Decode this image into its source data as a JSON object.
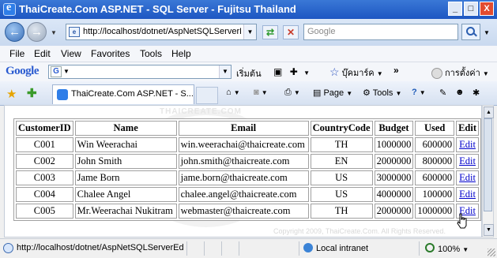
{
  "window": {
    "title": "ThaiCreate.Com ASP.NET - SQL Server - Fujitsu Thailand",
    "controls": {
      "minimize": "_",
      "maximize": "□",
      "close": "X"
    }
  },
  "nav": {
    "back_icon": "back-arrow-icon",
    "forward_icon": "forward-arrow-icon",
    "address": "http://localhost/dotnet/AspNetSQLServerE",
    "search_placeholder": "Google"
  },
  "menu": [
    "File",
    "Edit",
    "View",
    "Favorites",
    "Tools",
    "Help"
  ],
  "google_toolbar": {
    "logo": "Google",
    "start_label": "เริ่มต้น",
    "bookmarks_label": "บุ๊คมาร์ค",
    "more": "»",
    "settings_label": "การตั้งค่า"
  },
  "tabs": {
    "active_tab": "ThaiCreate.Com ASP.NET - S...",
    "page_label": "Page",
    "tools_label": "Tools"
  },
  "page": {
    "watermark": "THAICREATE.COM",
    "copyright": "Copyright 2009, ThaiCreate.Com. All Rights Reserved.",
    "table": {
      "headers": [
        "CustomerID",
        "Name",
        "Email",
        "CountryCode",
        "Budget",
        "Used",
        "Edit"
      ],
      "rows": [
        [
          "C001",
          "Win Weerachai",
          "win.weerachai@thaicreate.com",
          "TH",
          "1000000",
          "600000",
          "Edit"
        ],
        [
          "C002",
          "John Smith",
          "john.smith@thaicreate.com",
          "EN",
          "2000000",
          "800000",
          "Edit"
        ],
        [
          "C003",
          "Jame Born",
          "jame.born@thaicreate.com",
          "US",
          "3000000",
          "600000",
          "Edit"
        ],
        [
          "C004",
          "Chalee Angel",
          "chalee.angel@thaicreate.com",
          "US",
          "4000000",
          "100000",
          "Edit"
        ],
        [
          "C005",
          "Mr.Weerachai Nukitram",
          "webmaster@thaicreate.com",
          "TH",
          "2000000",
          "1000000",
          "Edit"
        ]
      ]
    }
  },
  "status": {
    "url": "http://localhost/dotnet/AspNetSQLServerEditFo",
    "zone": "Local intranet",
    "zoom": "100%"
  }
}
